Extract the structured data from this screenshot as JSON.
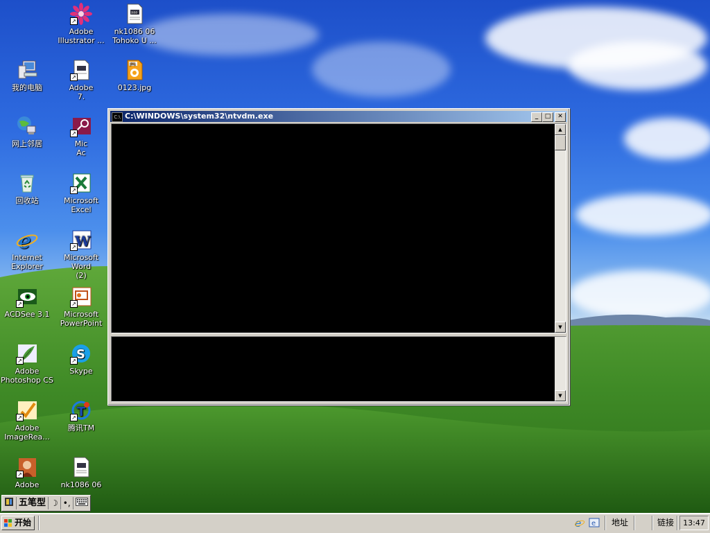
{
  "desktop": {
    "icons": [
      {
        "id": "illustrator",
        "label": "Adobe\nIllustrator ...",
        "icon": "flower-icon"
      },
      {
        "id": "nk1086-top",
        "label": "nk1086 06\nTohoko U ...",
        "icon": "document-icon"
      },
      {
        "id": "my-computer",
        "label": "我的电脑",
        "icon": "computer-icon"
      },
      {
        "id": "adobe-7",
        "label": "Adobe\n7.",
        "icon": "document-icon"
      },
      {
        "id": "jpg-0123",
        "label": "0123.jpg",
        "icon": "jpg-icon"
      },
      {
        "id": "network",
        "label": "网上邻居",
        "icon": "network-icon"
      },
      {
        "id": "access",
        "label": "Mic\nAc",
        "icon": "key-icon"
      },
      {
        "id": "recycle",
        "label": "回收站",
        "icon": "recycle-icon"
      },
      {
        "id": "excel",
        "label": "Microsoft Excel",
        "icon": "excel-icon"
      },
      {
        "id": "ie",
        "label": "Internet\nExplorer",
        "icon": "ie-icon"
      },
      {
        "id": "word",
        "label": "Microsoft Word\n(2)",
        "icon": "word-icon"
      },
      {
        "id": "acdsee",
        "label": "ACDSee 3.1",
        "icon": "eye-icon"
      },
      {
        "id": "powerpoint",
        "label": "Microsoft\nPowerPoint",
        "icon": "powerpoint-icon"
      },
      {
        "id": "photoshop",
        "label": "Adobe\nPhotoshop CS",
        "icon": "feather-icon"
      },
      {
        "id": "skype",
        "label": "Skype",
        "icon": "skype-icon"
      },
      {
        "id": "imageready",
        "label": "Adobe\nImageRea...",
        "icon": "imageready-icon"
      },
      {
        "id": "tencent",
        "label": "腾讯TM",
        "icon": "tencent-icon"
      },
      {
        "id": "adobe-bottom",
        "label": "Adobe",
        "icon": "portrait-icon"
      },
      {
        "id": "nk1086-bottom",
        "label": "nk1086 06\n...",
        "icon": "document-icon"
      }
    ]
  },
  "console": {
    "title": "C:\\WINDOWS\\system32\\ntvdm.exe",
    "icon_text": "C:\\",
    "buttons": {
      "minimize": "_",
      "maximize": "□",
      "close": "✕"
    }
  },
  "ime": {
    "name": "五笔型",
    "moon": "☽",
    "punct": "•,"
  },
  "taskbar": {
    "start_label": "开始",
    "address_label": "地址",
    "links_label": "链接",
    "clock": "13:47"
  },
  "colors": {
    "title_start": "#0a246a",
    "title_end": "#a6caf0",
    "face": "#d4d0c8"
  }
}
